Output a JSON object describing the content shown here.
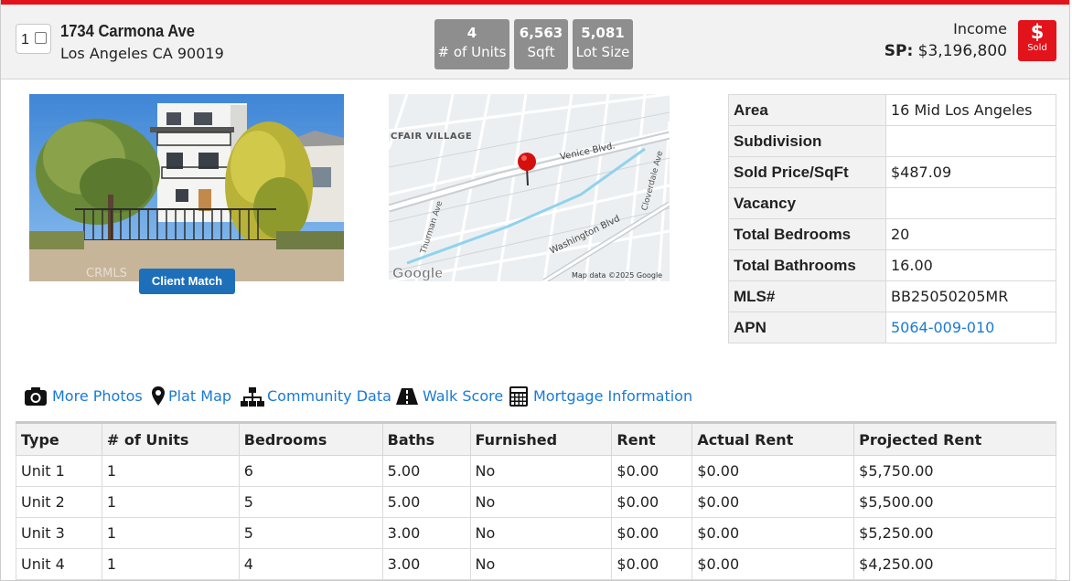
{
  "header": {
    "row_number": "1",
    "address_line1": "1734 Carmona Ave",
    "address_line2": "Los Angeles CA 90019",
    "stats": [
      {
        "value": "4",
        "label": "# of Units"
      },
      {
        "value": "6,563",
        "label": "Sqft"
      },
      {
        "value": "5,081",
        "label": "Lot Size"
      }
    ],
    "property_type": "Income",
    "sp_label": "SP:",
    "sp_value": "$3,196,800",
    "status_symbol": "$",
    "status_text": "Sold"
  },
  "photo": {
    "watermark": "CRMLS",
    "client_match_label": "Client Match"
  },
  "map": {
    "labels": [
      "CFAIR VILLAGE",
      "Venice Blvd.",
      "Washington Blvd",
      "Thurman Ave",
      "Cloverdale Ave"
    ],
    "logo": "Google",
    "attribution": "Map data ©2025 Google"
  },
  "details": [
    {
      "label": "Area",
      "value": "16 Mid Los Angeles"
    },
    {
      "label": "Subdivision",
      "value": ""
    },
    {
      "label": "Sold Price/SqFt",
      "value": "$487.09"
    },
    {
      "label": "Vacancy",
      "value": ""
    },
    {
      "label": "Total Bedrooms",
      "value": "20"
    },
    {
      "label": "Total Bathrooms",
      "value": "16.00"
    },
    {
      "label": "MLS#",
      "value": "BB25050205MR"
    },
    {
      "label": "APN",
      "value": "5064-009-010"
    }
  ],
  "links": [
    {
      "label": "More Photos",
      "icon": "camera-icon"
    },
    {
      "label": "Plat Map",
      "icon": "map-pin-icon"
    },
    {
      "label": "Community Data",
      "icon": "sitemap-icon"
    },
    {
      "label": "Walk Score",
      "icon": "road-icon"
    },
    {
      "label": "Mortgage Information",
      "icon": "calculator-icon"
    }
  ],
  "units_table": {
    "columns": [
      "Type",
      "# of Units",
      "Bedrooms",
      "Baths",
      "Furnished",
      "Rent",
      "Actual Rent",
      "Projected Rent"
    ],
    "rows": [
      [
        "Unit 1",
        "1",
        "6",
        "5.00",
        "No",
        "$0.00",
        "$0.00",
        "$5,750.00"
      ],
      [
        "Unit 2",
        "1",
        "5",
        "5.00",
        "No",
        "$0.00",
        "$0.00",
        "$5,500.00"
      ],
      [
        "Unit 3",
        "1",
        "5",
        "3.00",
        "No",
        "$0.00",
        "$0.00",
        "$5,250.00"
      ],
      [
        "Unit 4",
        "1",
        "4",
        "3.00",
        "No",
        "$0.00",
        "$0.00",
        "$4,250.00"
      ]
    ]
  },
  "colors": {
    "accent_red": "#e3131b",
    "link_blue": "#1a7ad4",
    "button_blue": "#1e6fba",
    "stat_gray": "#8e8e8e"
  }
}
